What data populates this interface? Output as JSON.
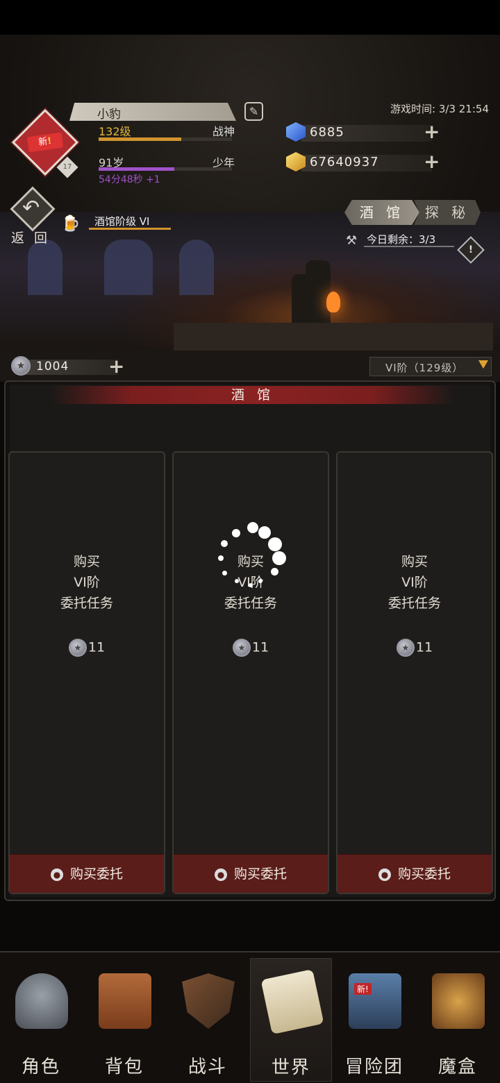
{
  "player": {
    "name": "小豹",
    "level": "132级",
    "title": "战神",
    "age": "91岁",
    "age_stage": "少年",
    "timer": "54分48秒 +1",
    "avatar_badge_prefix": "新",
    "avatar_badge_mark": "!",
    "avatar_level": "17",
    "level_progress": 0.62,
    "age_progress": 0.57
  },
  "game_time": "游戏时间: 3/3 21:54",
  "currencies": {
    "diamond": "6885",
    "gold": "67640937"
  },
  "back": {
    "label": "返 回"
  },
  "tavern": {
    "level_label": "酒馆阶级 VI",
    "tabs": [
      {
        "label": "酒 馆",
        "active": true
      },
      {
        "label": "探 秘",
        "active": false
      }
    ],
    "remaining": "今日剩余：3/3",
    "info_mark": "!"
  },
  "coins": {
    "amount": "1004",
    "tier_select": "VI阶（129级）"
  },
  "panel": {
    "title": "酒 馆",
    "cards": [
      {
        "line1": "购买",
        "line2": "VI阶",
        "line3": "委托任务",
        "price": "11",
        "button": "购买委托"
      },
      {
        "line1": "购买",
        "line2": "VI阶",
        "line3": "委托任务",
        "price": "11",
        "button": "购买委托"
      },
      {
        "line1": "购买",
        "line2": "VI阶",
        "line3": "委托任务",
        "price": "11",
        "button": "购买委托"
      }
    ]
  },
  "nav": [
    {
      "label": "角色",
      "icon": "helmet-icon"
    },
    {
      "label": "背包",
      "icon": "backpack-icon"
    },
    {
      "label": "战斗",
      "icon": "sword-shield-icon"
    },
    {
      "label": "世界",
      "icon": "scroll-icon",
      "active": true
    },
    {
      "label": "冒险团",
      "icon": "castle-icon",
      "badge": "新!"
    },
    {
      "label": "魔盒",
      "icon": "magic-box-icon"
    }
  ],
  "colors": {
    "accent_red": "#b02a2e",
    "button_red": "#5a1d1a",
    "gold_bar": "#d0952f",
    "purple_bar": "#a052c8"
  }
}
